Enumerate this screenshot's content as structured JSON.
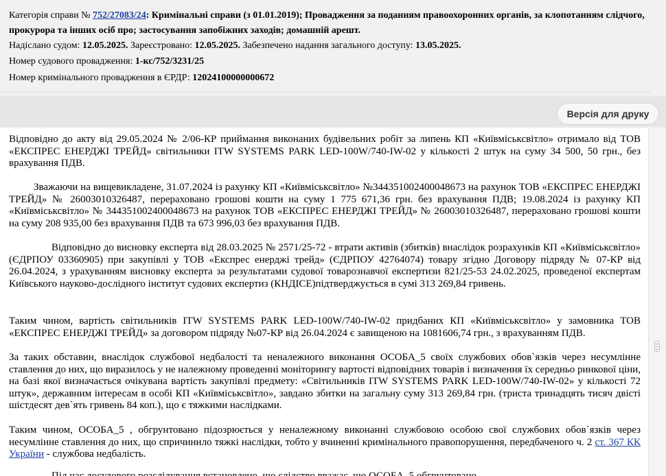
{
  "header": {
    "category_label": "Категорія справи № ",
    "case_link": "752/27083/24",
    "category_sep": ": ",
    "category_value_1": "Кримінальні справи (з 01.01.2019); Провадження за поданням правоохоронних органів, за клопотанням слідчого,",
    "category_value_2": "прокурора та інших осіб про; застосування запобіжних заходів; домашній арешт.",
    "sent_label": "Надіслано судом: ",
    "sent_date": "12.05.2025.",
    "registered_label": " Зареєстровано: ",
    "registered_date": "12.05.2025.",
    "access_label": " Забезпечено надання загального доступу: ",
    "access_date": "13.05.2025.",
    "court_proc_label": "Номер судового провадження: ",
    "court_proc_value": "1-кс/752/3231/25",
    "erdr_label": "Номер кримінального провадження в ЄРДР: ",
    "erdr_value": "12024100000000672"
  },
  "toolbar": {
    "print_label": "Версія для друку"
  },
  "document": {
    "p1": "Відповідно до акту від 29.05.2024 № 2/06-КР приймання виконаних будівельних робіт за липень КП «Київміськсвітло» отримало від ТОВ «ЕКСПРЕС ЕНЕРДЖІ ТРЕЙД» світильники ITW SYSTEMS PARK LED-100W/740-IW-02 у кількості 2 штук на суму 34 500, 50 грн., без врахування ПДВ.",
    "p2": "Зважаючи на вищевикладене, 31.07.2024 із рахунку КП «Київміськсвітло» №344351002400048673 на рахунок ТОВ «ЕКСПРЕС ЕНЕРДЖІ ТРЕЙД» № 26003010326487, перераховано грошові кошти на суму 1 775 671,36 грн. без врахування ПДВ; 19.08.2024 із рахунку КП «Київміськсвітло» № 344351002400048673 на рахунок ТОВ «ЕКСПРЕС ЕНЕРДЖІ ТРЕЙД» № 26003010326487, перераховано грошові кошти на суму 208 935,00 без врахування ПДВ та 673 996,03 без врахування ПДВ.",
    "p3": "Відповідно до висновку експерта від 28.03.2025 № 2571/25-72 - втрати активів (збитків) внаслідок розрахунків КП «Київміськсвітло» (ЄДРПОУ 03360905) при закупівлі у ТОВ «Експрес енерджі трейд» (ЄДРПОУ 42764074) товару згідно Договору підряду № 07-КР від 26.04.2024, з урахуванням висновку експерта за результатами судової товарознавчої експертизи 821/25-53 24.02.2025, проведеної експертам Київського науково-дослідного інститут судових експертиз (КНДІСЕ)підтверджується в сумі 313 269,84 гривень.",
    "p4": "Таким чином, вартість світильників ITW SYSTEMS PARK LED-100W/740-IW-02 придбаних КП «Київміськсвітло» у замовника ТОВ «ЕКСПРЕС ЕНЕРДЖІ ТРЕЙД» за договором підряду №07-КР від 26.04.2024 є завищеною на 1081606,74 грн., з врахуванням ПДВ.",
    "p5": "За таких обставин, внаслідок службової недбалості та неналежного виконання ОСОБА_5 своїх службових обов`язків через несумлінне ставлення до них, що виразилось у не належному проведенні моніторингу вартості відповідних товарів і визначення їх середньо ринкової ціни, на базі якої визначається очікувана вартість закупівлі предмету: «Світильників ITW SYSTEMS PARK LED-100W/740-IW-02» у кількості 72 штук», державним інтересам в особі КП «Київміськсвітло», завдано збитки на загальну суму 313 269,84 грн. (триста тринадцять тисяч двісті шістдесят дев`ять гривень 84 коп.), що є тяжкими наслідками.",
    "p6_text": "Таким чином, ОСОБА_5 , обгрунтовано підозрюється у неналежному виконанні службовою особою свої службових обов`язків через несумлінне ставлення до них, що спричинило тяжкі наслідки, тобто у вчиненні кримінального правопорушення, передбаченого ч. 2 ",
    "p6_link": "ст. 367 КК України",
    "p6_tail": " - службова недбалість.",
    "p7": "Під час досудового розслідування встановлено, що слідство вважає, що ОСОБА_5 обгрунтовано"
  }
}
